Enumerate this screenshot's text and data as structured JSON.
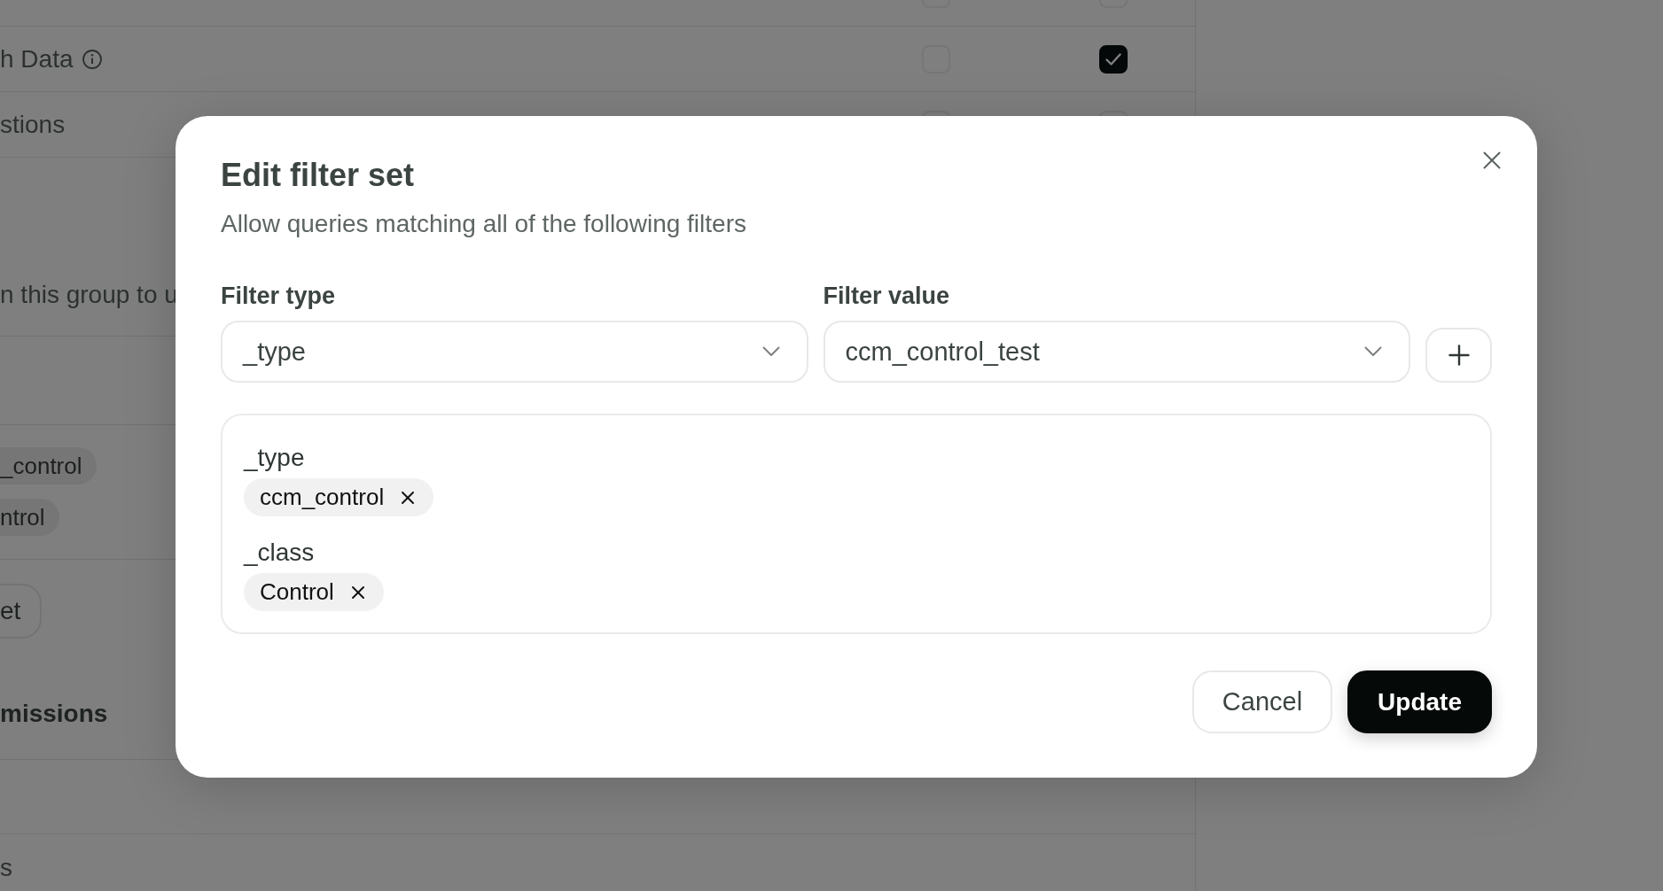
{
  "background": {
    "permission_rows": [
      {
        "checks": [
          {
            "checked": false
          },
          {
            "checked": false
          }
        ]
      },
      {
        "label": "h Data",
        "info_icon": true,
        "checks": [
          {
            "checked": false
          },
          {
            "checked": true
          }
        ]
      },
      {
        "label": "stions",
        "checks": [
          {
            "checked": false
          },
          {
            "checked": false
          }
        ]
      }
    ],
    "group_description": "n this group to u",
    "tags": [
      "_control",
      "ntrol"
    ],
    "button": "et",
    "section_heading": "missions",
    "bottom_text": "s"
  },
  "dialog": {
    "title": "Edit filter set",
    "description": "Allow queries matching all of the following filters",
    "filter_type": {
      "label": "Filter type",
      "value": "_type"
    },
    "filter_value": {
      "label": "Filter value",
      "value": "ccm_control_test"
    },
    "filter_groups": [
      {
        "name": "_type",
        "values": [
          "ccm_control"
        ]
      },
      {
        "name": "_class",
        "values": [
          "Control"
        ]
      }
    ],
    "buttons": [
      {
        "label": "Cancel",
        "kind": "secondary"
      },
      {
        "label": "Update",
        "kind": "primary"
      }
    ]
  }
}
